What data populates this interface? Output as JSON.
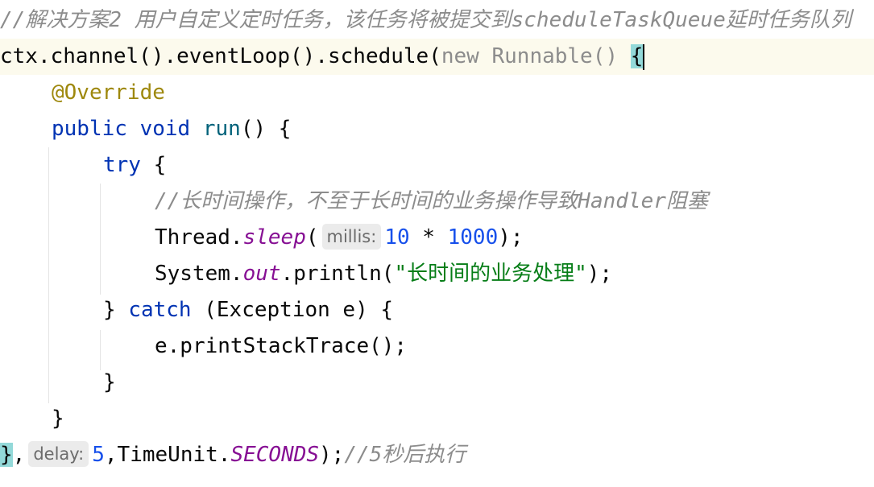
{
  "editor": {
    "lines": [
      {
        "tokens": [
          {
            "t": "//解决方案2 用户自定义定时任务，该任务将被提交到scheduleTaskQueue延时任务队列",
            "c": "comment"
          }
        ]
      },
      {
        "current": true,
        "tokens": [
          {
            "t": "ctx.channel().eventLoop().schedule(",
            "c": ""
          },
          {
            "t": "new Runnable() ",
            "c": "gray"
          },
          {
            "t": "{",
            "c": "brace-match"
          }
        ]
      },
      {
        "indent": 1,
        "tokens": [
          {
            "t": "@Override",
            "c": "annotation"
          }
        ]
      },
      {
        "indent": 1,
        "tokens": [
          {
            "t": "public void ",
            "c": "keyword"
          },
          {
            "t": "run",
            "c": "method"
          },
          {
            "t": "() {",
            "c": ""
          }
        ]
      },
      {
        "indent": 2,
        "tokens": [
          {
            "t": "try",
            "c": "keyword"
          },
          {
            "t": " {",
            "c": ""
          }
        ]
      },
      {
        "indent": 3,
        "tokens": [
          {
            "t": "//长时间操作，不至于长时间的业务操作导致Handler阻塞",
            "c": "comment"
          }
        ]
      },
      {
        "indent": 3,
        "tokens": [
          {
            "t": "Thread.",
            "c": ""
          },
          {
            "t": "sleep",
            "c": "static-field"
          },
          {
            "t": "(",
            "c": ""
          },
          {
            "hint": "millis:"
          },
          {
            "t": "10",
            "c": "number"
          },
          {
            "t": " * ",
            "c": ""
          },
          {
            "t": "1000",
            "c": "number"
          },
          {
            "t": ");",
            "c": ""
          }
        ]
      },
      {
        "indent": 3,
        "tokens": [
          {
            "t": "System.",
            "c": ""
          },
          {
            "t": "out",
            "c": "static-field"
          },
          {
            "t": ".println(",
            "c": ""
          },
          {
            "t": "\"长时间的业务处理\"",
            "c": "string"
          },
          {
            "t": ");",
            "c": ""
          }
        ]
      },
      {
        "indent": 2,
        "tokens": [
          {
            "t": "} ",
            "c": ""
          },
          {
            "t": "catch",
            "c": "keyword"
          },
          {
            "t": " (Exception e) {",
            "c": ""
          }
        ]
      },
      {
        "indent": 3,
        "tokens": [
          {
            "t": "e.printStackTrace();",
            "c": ""
          }
        ]
      },
      {
        "indent": 2,
        "tokens": [
          {
            "t": "}",
            "c": ""
          }
        ]
      },
      {
        "indent": 1,
        "tokens": [
          {
            "t": "}",
            "c": ""
          }
        ]
      },
      {
        "tokens": [
          {
            "t": "}",
            "c": "brace-match"
          },
          {
            "t": ",",
            "c": ""
          },
          {
            "hint": "delay:"
          },
          {
            "t": "5",
            "c": "number"
          },
          {
            "t": ",TimeUnit.",
            "c": ""
          },
          {
            "t": "SECONDS",
            "c": "const"
          },
          {
            "t": ");",
            "c": ""
          },
          {
            "t": "//5秒后执行",
            "c": "comment"
          }
        ]
      }
    ],
    "colors": {
      "keyword": "#0033b3",
      "comment": "#8c8c8c",
      "annotation": "#9e880d",
      "number": "#1750eb",
      "string": "#067d17",
      "static": "#871094",
      "method": "#00627a",
      "brace_match": "#93d9d9",
      "current_line": "#fcfaed"
    }
  }
}
